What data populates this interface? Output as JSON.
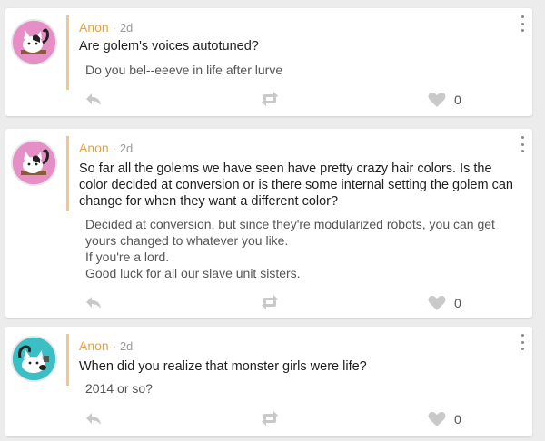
{
  "colors": {
    "author": "#e8a13a",
    "quote_bar": "#f2c78e",
    "avatar_pink": "#e58fc6",
    "avatar_teal": "#3bbfc4"
  },
  "posts": [
    {
      "author": "Anon",
      "separator": "·",
      "time": "2d",
      "question": "Are golem's voices autotuned?",
      "answer_lines": [
        "Do you bel--eeeve in life after lurve"
      ],
      "likes": "0",
      "avatar": "pink"
    },
    {
      "author": "Anon",
      "separator": "·",
      "time": "2d",
      "question": "So far all the golems we have seen have pretty crazy hair colors. Is the color decided at conversion or is there some internal setting the golem can change for when they want a different color?",
      "answer_lines": [
        "Decided at conversion, but since they're modularized robots, you can get yours changed to whatever you like.",
        "If you're a lord.",
        "Good luck for all our slave unit sisters."
      ],
      "likes": "0",
      "avatar": "pink"
    },
    {
      "author": "Anon",
      "separator": "·",
      "time": "2d",
      "question": "When did you realize that monster girls were life?",
      "answer_lines": [
        "2014 or so?"
      ],
      "likes": "0",
      "avatar": "teal"
    }
  ],
  "icons": [
    "reply-icon",
    "repost-icon",
    "heart-icon",
    "more-options-icon",
    "cat-avatar-icon"
  ]
}
